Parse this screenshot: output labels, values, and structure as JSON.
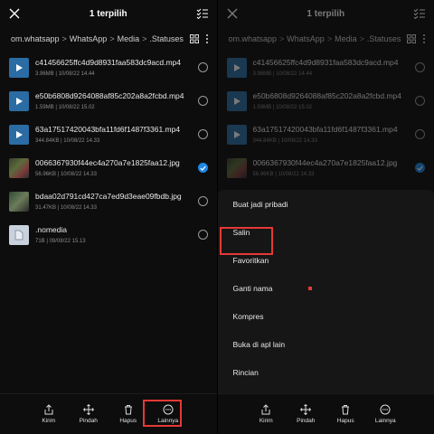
{
  "left": {
    "title": "1 terpilih",
    "path": [
      "om.whatsapp",
      "WhatsApp",
      "Media",
      ".Statuses"
    ],
    "path_sep": ">",
    "files": [
      {
        "name": "c41456625ffc4d9d8931faa583dc9acd.mp4",
        "size": "3.96MB",
        "date": "10/08/22 14.44",
        "kind": "video",
        "selected": false
      },
      {
        "name": "e50b6808d9264088af85c202a8a2fcbd.mp4",
        "size": "1.59MB",
        "date": "10/08/22 15.02",
        "kind": "video",
        "selected": false
      },
      {
        "name": "63a17517420043bfa11fd6f1487f3361.mp4",
        "size": "344.84KB",
        "date": "10/08/22 14.33",
        "kind": "video",
        "selected": false
      },
      {
        "name": "0066367930f44ec4a270a7e1825faa12.jpg",
        "size": "56.96KB",
        "date": "10/08/22 14.33",
        "kind": "image",
        "selected": true
      },
      {
        "name": "bdaa02d791cd427ca7ed9d3eae09fbdb.jpg",
        "size": "31.47KB",
        "date": "10/08/22 14.33",
        "kind": "image2",
        "selected": false
      },
      {
        "name": ".nomedia",
        "size": "71B",
        "date": "09/08/22 15.13",
        "kind": "doc",
        "selected": false
      }
    ],
    "bottom": [
      {
        "label": "Kirim",
        "icon": "share-icon"
      },
      {
        "label": "Pindah",
        "icon": "move-icon"
      },
      {
        "label": "Hapus",
        "icon": "trash-icon"
      },
      {
        "label": "Lainnya",
        "icon": "more-icon"
      }
    ]
  },
  "right": {
    "title": "1 terpilih",
    "path": [
      "om.whatsapp",
      "WhatsApp",
      "Media",
      ".Statuses"
    ],
    "path_sep": ">",
    "files": [
      {
        "name": "c41456625ffc4d9d8931faa583dc9acd.mp4",
        "size": "3.96MB",
        "date": "10/08/22 14.44"
      },
      {
        "name": "e50b6808d9264088af85c202a8a2fcbd.mp4",
        "size": "1.59MB",
        "date": "10/08/22 15.02"
      },
      {
        "name": "63a17517420043bfa11fd6f1487f3361.mp4",
        "size": "344.84KB",
        "date": "10/08/22 14.33"
      },
      {
        "name": "0066367930f44ec4a270a7e1825faa12.jpg",
        "size": "56.96KB",
        "date": "10/08/22 14.33"
      }
    ],
    "menu": [
      "Buat jadi pribadi",
      "Salin",
      "Favoritkan",
      "Ganti nama",
      "Kompres",
      "Buka di apl lain",
      "Rincian"
    ],
    "bottom": [
      {
        "label": "Kirim",
        "icon": "share-icon"
      },
      {
        "label": "Pindah",
        "icon": "move-icon"
      },
      {
        "label": "Hapus",
        "icon": "trash-icon"
      },
      {
        "label": "Lainnya",
        "icon": "more-icon"
      }
    ]
  },
  "colors": {
    "accent": "#1e88e5",
    "highlight": "#e53935",
    "video_thumb": "#2a6ca3"
  }
}
